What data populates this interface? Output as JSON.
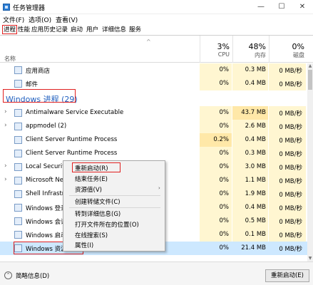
{
  "window": {
    "title": "任务管理器",
    "controls": {
      "minimize": "—",
      "maximize": "☐",
      "close": "✕"
    }
  },
  "menubar": {
    "items": [
      {
        "label": "文件(F)"
      },
      {
        "label": "选项(O)"
      },
      {
        "label": "查看(V)"
      }
    ]
  },
  "tabs": [
    {
      "label": "进程"
    },
    {
      "label": "性能"
    },
    {
      "label": "应用历史记录"
    },
    {
      "label": "启动"
    },
    {
      "label": "用户"
    },
    {
      "label": "详细信息"
    },
    {
      "label": "服务"
    }
  ],
  "header": {
    "name_label": "名称",
    "sort_caret": "^",
    "cpu": {
      "pct": "3%",
      "label": "CPU"
    },
    "memory": {
      "pct": "48%",
      "label": "内存"
    },
    "disk": {
      "pct": "0%",
      "label": "磁盘"
    }
  },
  "rows_top": [
    {
      "name": "应用商店",
      "cpu": "0%",
      "mem": "0.3 MB",
      "disk": "0 MB/秒"
    },
    {
      "name": "邮件",
      "cpu": "0%",
      "mem": "0.4 MB",
      "disk": "0 MB/秒"
    }
  ],
  "group": {
    "title": "Windows 进程 (29)"
  },
  "rows": [
    {
      "expand": "›",
      "name": "Antimalware Service Executable",
      "cpu": "0%",
      "mem": "43.7 MB",
      "disk": "0 MB/秒"
    },
    {
      "expand": "›",
      "name": "appmodel (2)",
      "cpu": "0%",
      "mem": "2.6 MB",
      "disk": "0 MB/秒"
    },
    {
      "expand": "",
      "name": "Client Server Runtime Process",
      "cpu": "0.2%",
      "mem": "0.4 MB",
      "disk": "0 MB/秒"
    },
    {
      "expand": "",
      "name": "Client Server Runtime Process",
      "cpu": "0%",
      "mem": "0.3 MB",
      "disk": "0 MB/秒"
    },
    {
      "expand": "›",
      "name": "Local Security",
      "cpu": "0%",
      "mem": "3.0 MB",
      "disk": "0 MB/秒"
    },
    {
      "expand": "›",
      "name": "Microsoft Ne",
      "cpu": "0%",
      "mem": "1.1 MB",
      "disk": "0 MB/秒"
    },
    {
      "expand": "",
      "name": "Shell Infrastru",
      "cpu": "0%",
      "mem": "1.9 MB",
      "disk": "0 MB/秒"
    },
    {
      "expand": "",
      "name": "Windows 登录",
      "cpu": "0%",
      "mem": "0.4 MB",
      "disk": "0 MB/秒"
    },
    {
      "expand": "",
      "name": "Windows 会话",
      "cpu": "0%",
      "mem": "0.5 MB",
      "disk": "0 MB/秒"
    },
    {
      "expand": "",
      "name": "Windows 启动",
      "cpu": "0%",
      "mem": "0.1 MB",
      "disk": "0 MB/秒"
    },
    {
      "expand": "",
      "name": "Windows 资源",
      "cpu": "0%",
      "mem": "21.4 MB",
      "disk": "0 MB/秒"
    }
  ],
  "context_menu": {
    "items": [
      {
        "label": "重新启动(R)"
      },
      {
        "label": "结束任务(E)"
      },
      {
        "label": "资源值(V)",
        "arrow": "›"
      },
      {
        "label": "创建转储文件(C)"
      },
      {
        "label": "转到详细信息(G)"
      },
      {
        "label": "打开文件所在的位置(O)"
      },
      {
        "label": "在线搜索(S)"
      },
      {
        "label": "属性(I)"
      }
    ]
  },
  "footer": {
    "fewer_icon": "⌃",
    "fewer_label": "简略信息(D)",
    "restart_label": "重新启动(E)"
  },
  "colors": {
    "accent_red": "#e02020",
    "group_blue": "#1f5fbf",
    "cell_yellow": "#fff6d1"
  }
}
